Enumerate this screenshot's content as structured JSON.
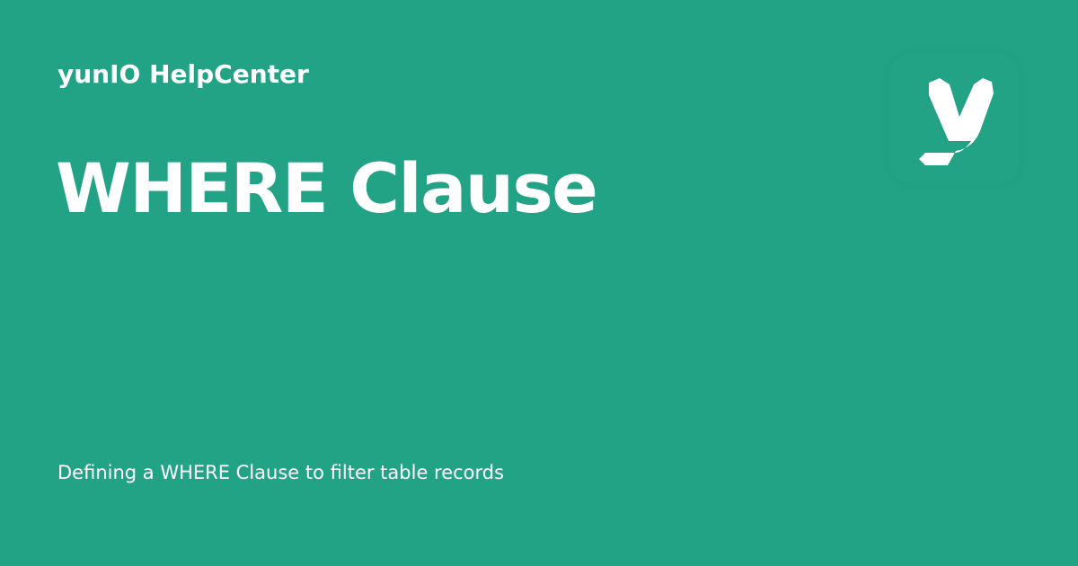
{
  "header": {
    "site_name": "yunIO HelpCenter"
  },
  "article": {
    "title": "WHERE Clause",
    "description": "Defining a WHERE Clause to filter table records"
  },
  "brand": {
    "logo_icon": "yunio-y-logo-icon",
    "background_color": "#22a386",
    "foreground_color": "#ffffff"
  }
}
